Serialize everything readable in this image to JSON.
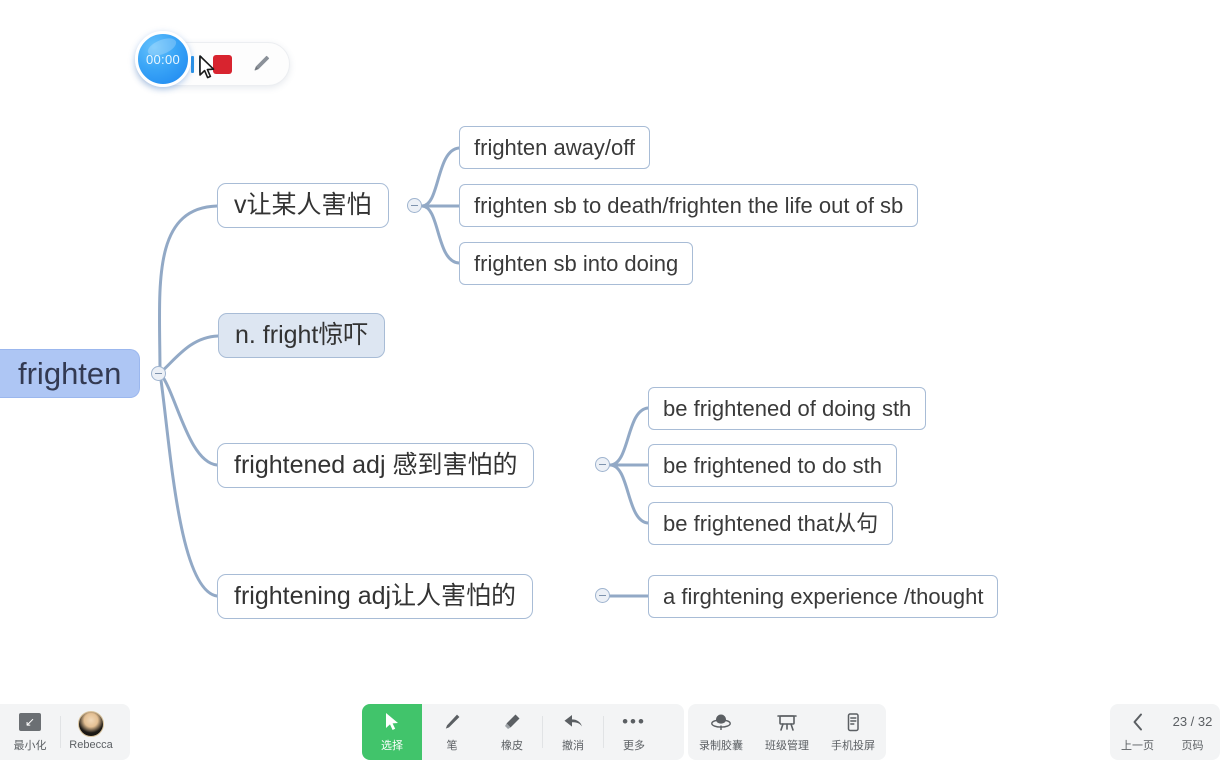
{
  "recorder": {
    "timer": "00:00",
    "pause_label": "pause",
    "stop_label": "stop",
    "pen_label": "pen"
  },
  "mindmap": {
    "root": {
      "label": "frighten"
    },
    "branches": [
      {
        "label": "v让某人害怕",
        "children": [
          {
            "label": "frighten away/off"
          },
          {
            "label": "frighten sb to death/frighten the life out of sb"
          },
          {
            "label": "frighten sb into doing"
          }
        ]
      },
      {
        "label": "n. fright惊吓",
        "children": []
      },
      {
        "label": "frightened adj 感到害怕的",
        "children": [
          {
            "label": "be frightened of doing sth"
          },
          {
            "label": "be frightened to do sth"
          },
          {
            "label": "be frightened that从句"
          }
        ]
      },
      {
        "label": "frightening adj让人害怕的",
        "children": [
          {
            "label": "a firghtening experience /thought"
          }
        ]
      }
    ]
  },
  "toolbar": {
    "left": [
      {
        "label": "最小化",
        "icon": "minimize-icon"
      },
      {
        "label": "Rebecca",
        "icon": "avatar"
      }
    ],
    "center": [
      {
        "label": "选择",
        "icon": "cursor-icon",
        "active": true
      },
      {
        "label": "笔",
        "icon": "pen-icon",
        "active": false
      },
      {
        "label": "橡皮",
        "icon": "eraser-icon",
        "active": false
      },
      {
        "label": "撤消",
        "icon": "undo-icon",
        "active": false
      },
      {
        "label": "更多",
        "icon": "more-icon",
        "active": false
      }
    ],
    "share": [
      {
        "label": "录制胶囊",
        "icon": "record-capsule-icon"
      },
      {
        "label": "班级管理",
        "icon": "class-manage-icon"
      },
      {
        "label": "手机投屏",
        "icon": "phone-cast-icon"
      }
    ],
    "right": {
      "prev_label": "上一页",
      "prev_icon": "chevron-left-icon",
      "page_value": "23 / 32",
      "page_label": "页码"
    }
  },
  "colors": {
    "accent_green": "#41c46b",
    "root_fill": "#aec6f4",
    "edge": "#92a9c6",
    "node_border": "#a8bcd6",
    "stop_red": "#d8242f",
    "timer_blue": "#2a93e8"
  }
}
